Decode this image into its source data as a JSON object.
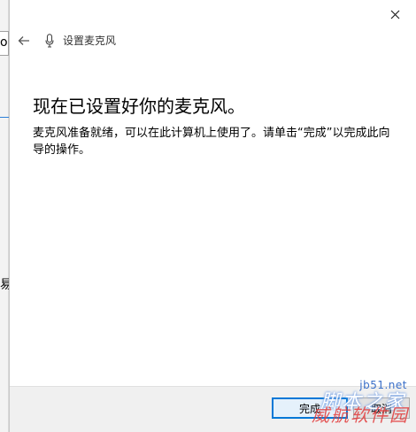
{
  "background": {
    "partial_text_top": "o",
    "partial_text_mid": "易"
  },
  "dialog": {
    "wizard_title": "设置麦克风",
    "heading": "现在已设置好你的麦克风。",
    "description": "麦克风准备就绪，可以在此计算机上使用了。请单击“完成”以完成此向导的操作。",
    "finish_label": "完成",
    "cancel_label": "取消"
  },
  "watermark": {
    "site": "jb51.net",
    "main": "脚本之家",
    "sub": "威航软件园"
  },
  "colors": {
    "accent": "#0078d7"
  }
}
